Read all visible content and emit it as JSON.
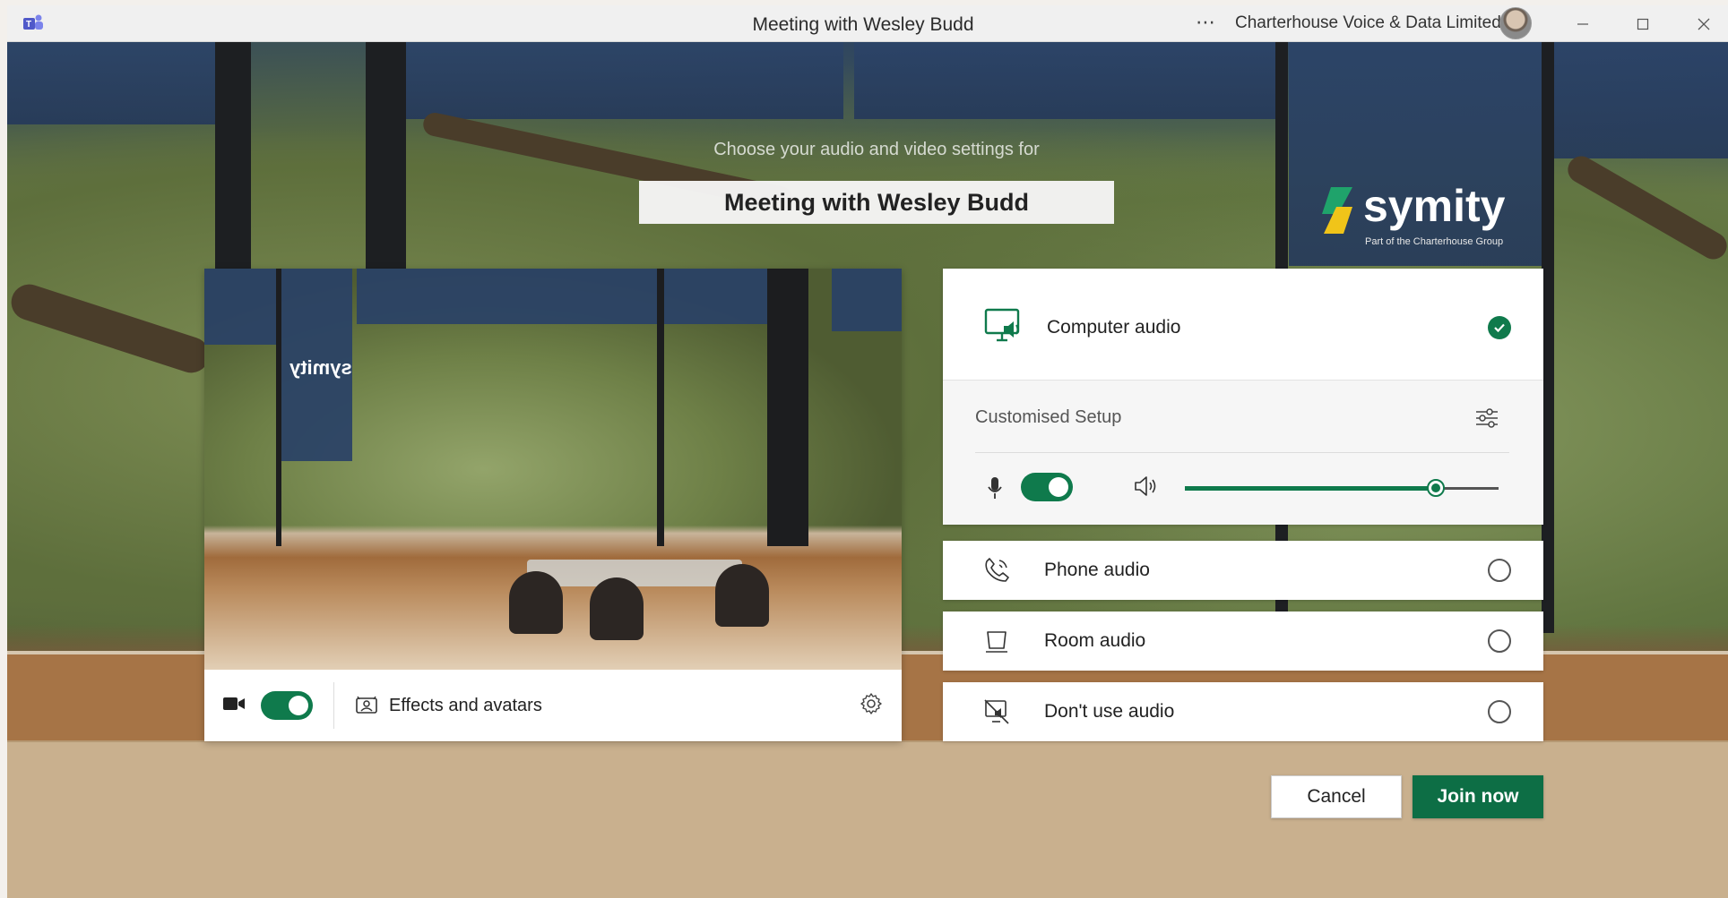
{
  "window": {
    "title": "Meeting with Wesley Budd",
    "more_icon": "ellipsis-icon",
    "organization": "Charterhouse Voice & Data Limited"
  },
  "prejoin": {
    "prompt": "Choose your audio and video settings for",
    "meeting_name": "Meeting with Wesley Budd"
  },
  "branding": {
    "name": "symity",
    "tagline": "Part of the Charterhouse Group",
    "preview_text": "symity"
  },
  "video": {
    "camera_on": true,
    "effects_label": "Effects and avatars",
    "settings_icon": "gear-icon"
  },
  "audio": {
    "computer": {
      "label": "Computer audio",
      "selected": true
    },
    "setup_label": "Customised Setup",
    "mic_on": true,
    "speaker_volume": 0.8,
    "options": [
      {
        "label": "Phone audio",
        "icon": "phone-icon",
        "selected": false
      },
      {
        "label": "Room audio",
        "icon": "room-device-icon",
        "selected": false
      },
      {
        "label": "Don't use audio",
        "icon": "no-audio-icon",
        "selected": false
      }
    ]
  },
  "actions": {
    "cancel": "Cancel",
    "join": "Join now"
  },
  "colors": {
    "accent": "#0f7a4c",
    "join_button": "#0d6e45"
  }
}
